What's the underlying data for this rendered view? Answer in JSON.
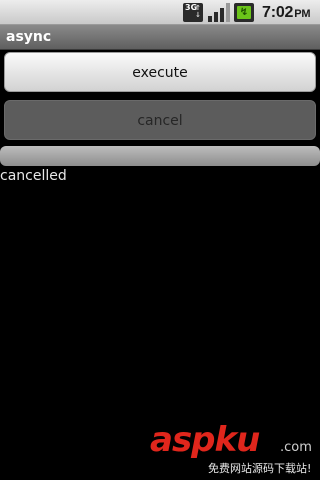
{
  "status_bar": {
    "network_label": "3G",
    "network_icon": "3g-data-icon",
    "signal_icon": "signal-strength-icon",
    "signal_level": 0.75,
    "battery_icon": "battery-charging-icon",
    "time": "7:02",
    "ampm": "PM"
  },
  "title_bar": {
    "title": "async"
  },
  "buttons": {
    "execute_label": "execute",
    "cancel_label": "cancel",
    "cancel_enabled": false
  },
  "progress": {
    "value": 0
  },
  "status_text": "cancelled",
  "watermark": {
    "logo_part1": "asp",
    "logo_part2": "ku",
    "domain_suffix": ".com",
    "subtitle": "免费网站源码下载站!"
  },
  "colors": {
    "background": "#000000",
    "watermark_red": "#e0261c",
    "battery_green": "#6bc41a"
  }
}
